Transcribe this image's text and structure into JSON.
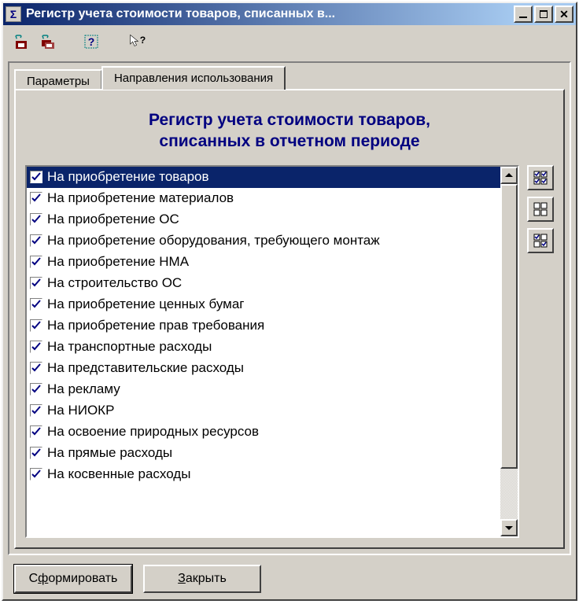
{
  "window": {
    "title": "Регистр учета стоимости товаров, списанных в...",
    "icon": "Σ"
  },
  "toolbar": {
    "icons": [
      "save-record-icon",
      "save-records-icon",
      "help-icon",
      "cursor-help-icon"
    ]
  },
  "tabs": {
    "items": [
      {
        "label": "Параметры",
        "active": false
      },
      {
        "label": "Направления использования",
        "active": true
      }
    ]
  },
  "heading": {
    "line1": "Регистр учета стоимости товаров,",
    "line2": "списанных в отчетном периоде"
  },
  "list": {
    "items": [
      {
        "label": "На приобретение товаров",
        "checked": true,
        "selected": true
      },
      {
        "label": "На приобретение материалов",
        "checked": true,
        "selected": false
      },
      {
        "label": "На приобретение ОС",
        "checked": true,
        "selected": false
      },
      {
        "label": "На приобретение оборудования, требующего монтаж",
        "checked": true,
        "selected": false
      },
      {
        "label": "На приобретение НМА",
        "checked": true,
        "selected": false
      },
      {
        "label": "На строительство ОС",
        "checked": true,
        "selected": false
      },
      {
        "label": "На приобретение ценных бумаг",
        "checked": true,
        "selected": false
      },
      {
        "label": "На приобретение прав требования",
        "checked": true,
        "selected": false
      },
      {
        "label": "На транспортные расходы",
        "checked": true,
        "selected": false
      },
      {
        "label": "На представительские расходы",
        "checked": true,
        "selected": false
      },
      {
        "label": "На рекламу",
        "checked": true,
        "selected": false
      },
      {
        "label": "На НИОКР",
        "checked": true,
        "selected": false
      },
      {
        "label": "На освоение природных ресурсов",
        "checked": true,
        "selected": false
      },
      {
        "label": "На прямые расходы",
        "checked": true,
        "selected": false
      },
      {
        "label": "На косвенные расходы",
        "checked": true,
        "selected": false
      }
    ]
  },
  "side_buttons": [
    "check-all-icon",
    "uncheck-all-icon",
    "invert-icon"
  ],
  "buttons": {
    "generate": {
      "pre": "С",
      "u": "ф",
      "post": "ормировать"
    },
    "close": {
      "pre": "",
      "u": "З",
      "post": "акрыть"
    }
  }
}
